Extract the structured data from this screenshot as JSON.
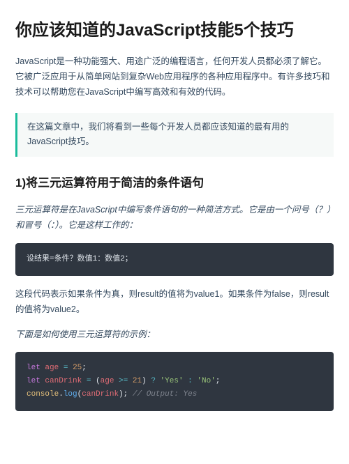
{
  "title": "你应该知道的JavaScript技能5个技巧",
  "intro": "JavaScript是一种功能强大、用途广泛的编程语言，任何开发人员都必须了解它。它被广泛应用于从简单网站到复杂Web应用程序的各种应用程序中。有许多技巧和技术可以帮助您在JavaScript中编写高效和有效的代码。",
  "callout": "在这篇文章中，我们将看到一些每个开发人员都应该知道的最有用的JavaScript技巧。",
  "section1": {
    "heading": "1)将三元运算符用于简洁的条件语句",
    "lead": "三元运算符是在JavaScript中编写条件语句的一种简洁方式。它是由一个问号（？）和冒号（：）。它是这样工作的：",
    "code1": "设结果=条件？数值1：数值2；",
    "explain": "这段代码表示如果条件为真，则result的值将为value1。如果条件为false，则result的值将为value2。",
    "lead2": "下面是如何使用三元运算符的示例：",
    "code2": {
      "l1_let": "let",
      "l1_var": "age",
      "l1_eq": "=",
      "l1_num": "25",
      "l1_semi": ";",
      "l2_let": "let",
      "l2_var": "canDrink",
      "l2_eq": "=",
      "l2_open": "(",
      "l2_var2": "age",
      "l2_op": ">=",
      "l2_num": "21",
      "l2_close": ")",
      "l2_q": "?",
      "l2_s1": "'Yes'",
      "l2_colon": ":",
      "l2_s2": "'No'",
      "l2_semi": ";",
      "l3_obj": "console",
      "l3_dot": ".",
      "l3_fn": "log",
      "l3_open": "(",
      "l3_var": "canDrink",
      "l3_close": ")",
      "l3_semi": ";",
      "l3_cmt": "// Output: Yes"
    }
  }
}
